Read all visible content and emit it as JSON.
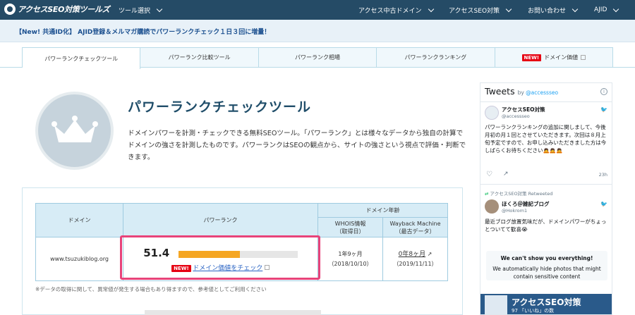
{
  "header": {
    "logo": "アクセスSEO対策ツールズ",
    "nav_left": "ツール選択",
    "nav_right": [
      "アクセス中古ドメイン",
      "アクセスSEO対策",
      "お問い合わせ",
      "AJID"
    ]
  },
  "banner": {
    "text": "【New! 共通ID化】 AJID登録＆メルマガ購読でパワーランクチェック１日３回に増量！"
  },
  "tabs": [
    {
      "label": "パワーランクチェックツール",
      "active": true
    },
    {
      "label": "パワーランク比較ツール"
    },
    {
      "label": "パワーランク相場"
    },
    {
      "label": "パワーランクランキング"
    },
    {
      "label": "ドメイン価値",
      "badge": "NEW!"
    }
  ],
  "main": {
    "title": "パワーランクチェックツール",
    "description": "ドメインパワーを計測・チェックできる無料SEOツール。「パワーランク」とは様々なデータから独自の計算でドメインの強さを計測したものです。パワーランクはSEOの観点から、サイトの強さという視点で評価・判断できます。"
  },
  "result_table": {
    "headers": {
      "domain": "ドメイン",
      "powerrank": "パワーランク",
      "age": "ドメイン年齢",
      "whois": "WHOIS情報",
      "whois_sub": "（取得日）",
      "wayback": "Wayback Machine",
      "wayback_sub": "（最古データ）"
    },
    "row": {
      "domain": "www.tsuzukiblog.org",
      "score": "51.4",
      "score_fraction": 0.514,
      "new_badge": "NEW!",
      "check_link": "ドメイン価値をチェック",
      "whois_age": "1年9ヶ月",
      "whois_date": "（2018/10/10）",
      "wayback_age": "0年8ヶ月",
      "wayback_date": "（2019/11/11）"
    }
  },
  "note": "※データの取得に関して、異常値が発生する場合もあり得ますので、参考値としてご利用ください",
  "twitter": {
    "title": "Tweets",
    "by": "by",
    "handle": "@accessseo",
    "tweets": [
      {
        "name": "アクセスSEO対策",
        "handle": "@accessseo",
        "text": "パワーランクランキングの追加に関しまして、今後月初の月１回とさせていただきます。次回は８月上旬予定ですので、お申し込みいただきました方は今しばらくお待ちください🙇🙇🙇",
        "time": "23h"
      }
    ],
    "retweet_label": "アクセスSEO対策 Retweeted",
    "retweet": {
      "name": "ほくろ＠雑記ブログ",
      "handle": "@Hokrom1",
      "text": "最近ブログ放置気味だが、ドメインパワーがちょっとついてて歓喜😭"
    },
    "sensitive": {
      "title": "We can't show you everything!",
      "text": "We automatically hide photos that might contain sensitive content"
    },
    "promo": {
      "title": "アクセスSEO対策",
      "sub": "97 「いいね」の数"
    }
  },
  "colors": {
    "header_bg": "#254b66",
    "accent": "#e8437a",
    "bar": "#f5a623",
    "table_head": "#d7ecf6"
  }
}
